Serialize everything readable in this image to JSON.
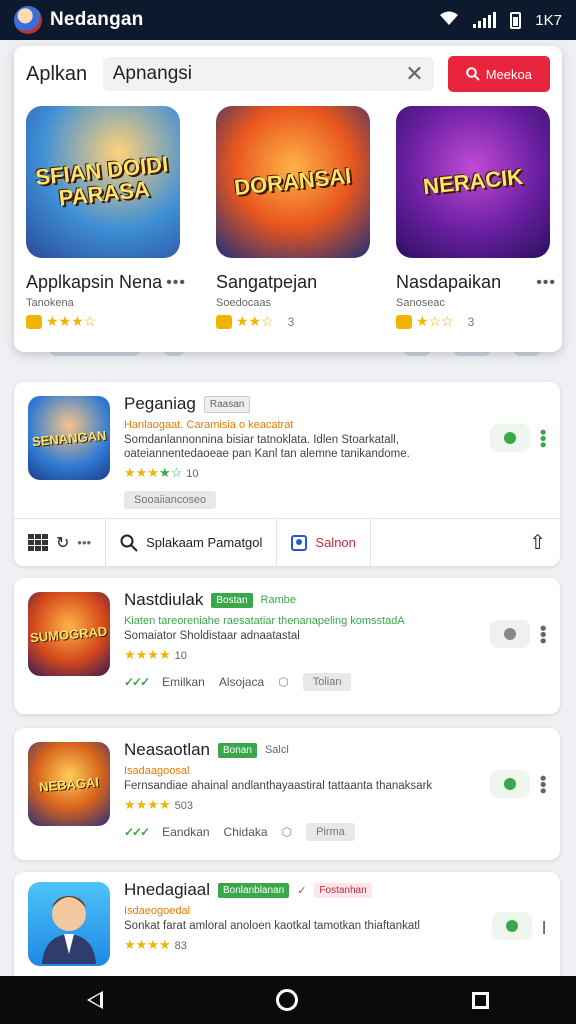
{
  "status_bar": {
    "title": "Nedangan",
    "time": "1K7"
  },
  "search": {
    "label": "Aplkan",
    "value": "Apnangsi",
    "button_label": "Meekoa"
  },
  "featured": [
    {
      "art": "SFIAN DOIDI PARASA",
      "name": "Applkapsin Nena",
      "sub": "Tanokena",
      "stars": "★★★☆",
      "count": ""
    },
    {
      "art": "DORANSAI",
      "name": "Sangatpejan",
      "sub": "Soedocaas",
      "stars": "★★☆",
      "count": "3"
    },
    {
      "art": "NERACIK",
      "name": "Nasdapaikan",
      "sub": "Sanoseac",
      "stars": "★☆☆",
      "count": "3"
    }
  ],
  "apps": [
    {
      "icon_text": "SENANGAN",
      "title": "Peganiag",
      "tag": "Raasan",
      "orange": "Hanlaogaat. Caramisia o keacatrat",
      "desc": "Somdanlannonnina bisiar tatnoklata. Idlen Stoarkatall, oateiannentedaoeae pan Kanl tan alemne tanikandome.",
      "stars": "★★★",
      "stars_green": "★☆",
      "count": "10",
      "footer": "Sooaiiancoseo"
    },
    {
      "icon_text": "SUMOGRAD",
      "title": "Nastdiulak",
      "tag": "Bostan",
      "tag_extra": "Rambe",
      "orange": "Kiaten tareoreniahe raesatatiar thenanapeling komsstadA",
      "desc": "Somaiator Sholdistaar adnaatastal",
      "stars": "★★★★",
      "count": "10",
      "meta_left": "Emilkan",
      "meta_mid": "Alsojaca",
      "meta_pill": "Tolian"
    },
    {
      "icon_text": "NEBAGAI",
      "title": "Neasaotlan",
      "tag": "Bonan",
      "tag_extra": "Salcl",
      "orange": "Isadaagoosal",
      "desc": "Fernsandiae ahainal andlanthayaastiral tattaanta thanaksark",
      "stars": "★★★★",
      "count": "503",
      "meta_left": "Eandkan",
      "meta_mid": "Chidaka",
      "meta_pill": "Pirma"
    },
    {
      "icon_text": "",
      "title": "Hnedagiaal",
      "tag": "Bonlanblanan",
      "tag_extra": "Fostanhan",
      "orange": "Isdaeogoedal",
      "desc": "Sonkat farat amloral anoloen kaotkal tamotkan thiaftankatl",
      "stars": "★★★★",
      "count": "83"
    }
  ],
  "toolbar": {
    "search_label": "Splakaam Pamatgol",
    "salon_label": "Salnon"
  },
  "colors": {
    "accent": "#e8253c",
    "green": "#3aa84a",
    "star": "#f1b400",
    "statusbar": "#0d1a2e"
  }
}
